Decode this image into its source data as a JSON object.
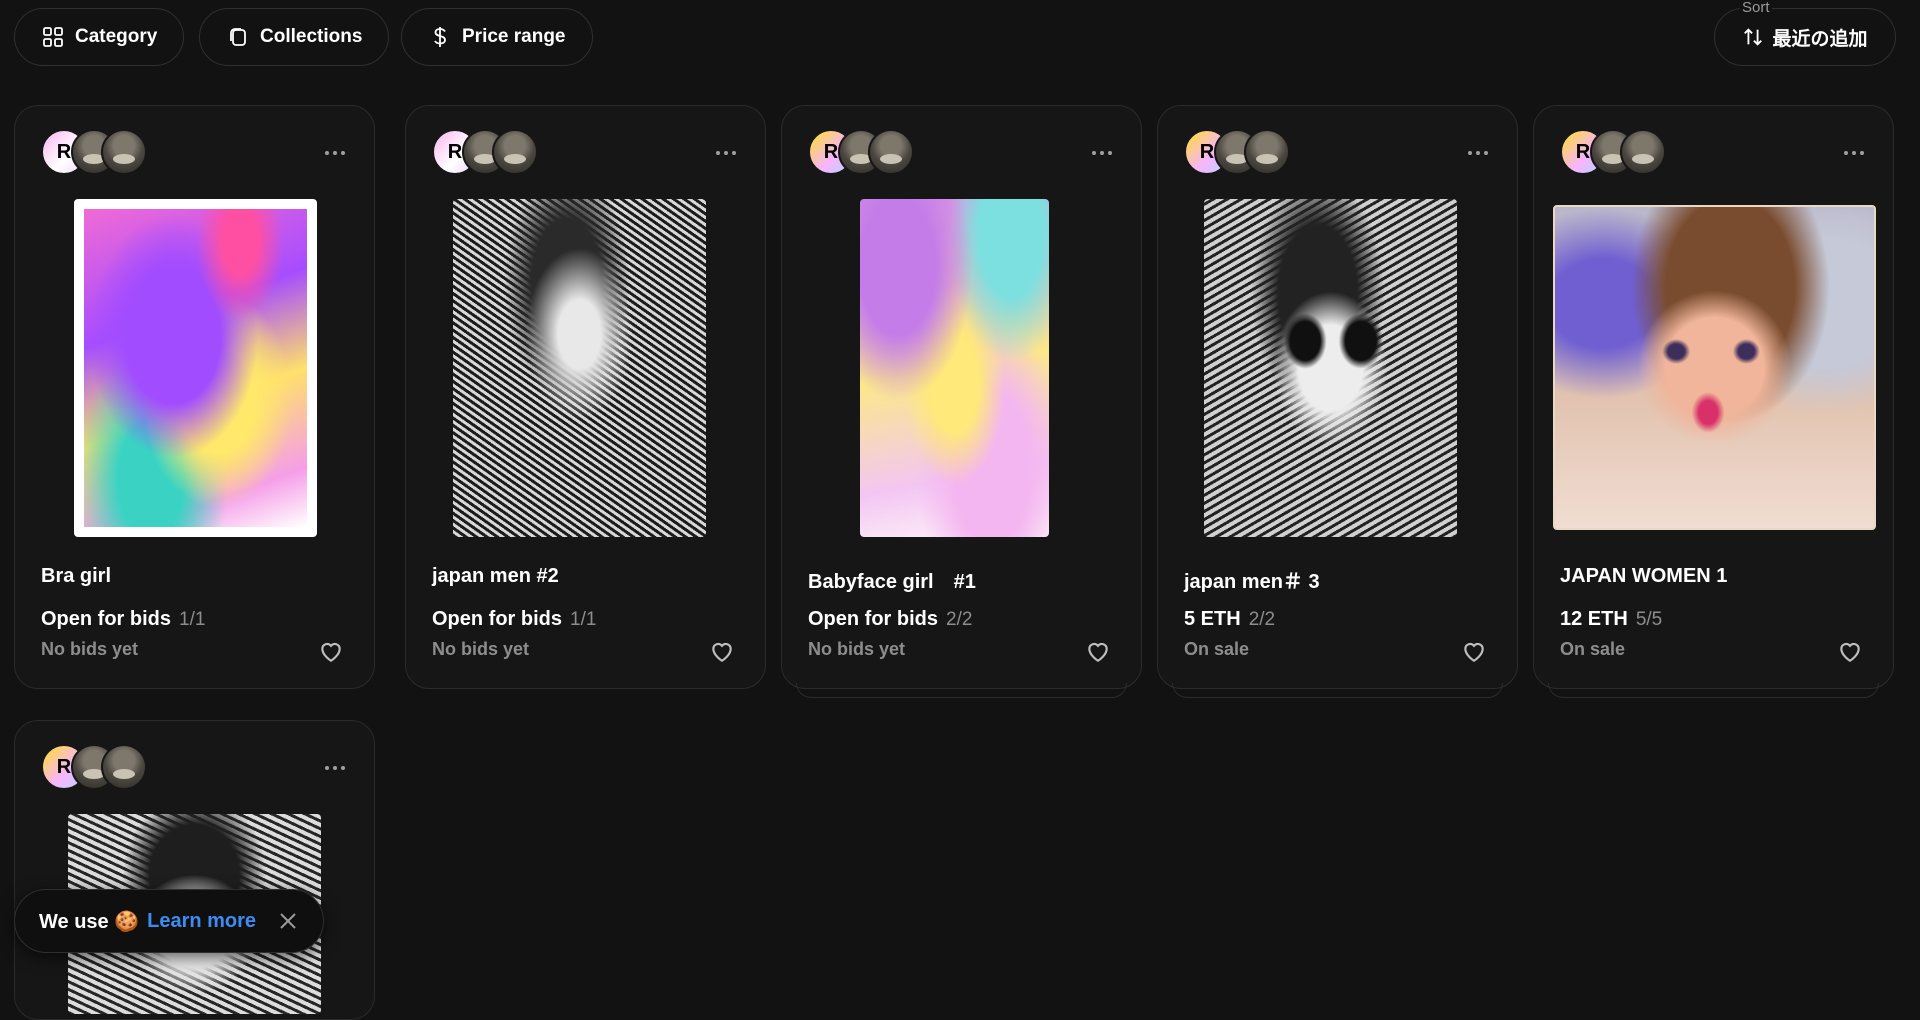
{
  "filters": {
    "category_label": "Category",
    "collections_label": "Collections",
    "price_label": "Price range"
  },
  "sort": {
    "label": "Sort",
    "value": "最近の追加"
  },
  "cards": [
    {
      "title": "Bra girl",
      "price": "Open for bids",
      "count": "1/1",
      "sub": "No bids yet",
      "avatar_badge": "R"
    },
    {
      "title": "japan men #2",
      "price": "Open for bids",
      "count": "1/1",
      "sub": "No bids yet",
      "avatar_badge": "R"
    },
    {
      "title": "Babyface girl　#1",
      "price": "Open for bids",
      "count": "2/2",
      "sub": "No bids yet",
      "avatar_badge": "R"
    },
    {
      "title": "japan men＃ 3",
      "price": "5 ETH",
      "count": "2/2",
      "sub": "On sale",
      "avatar_badge": "R"
    },
    {
      "title": "JAPAN WOMEN 1",
      "price": "12 ETH",
      "count": "5/5",
      "sub": "On sale",
      "avatar_badge": "R"
    },
    {
      "title": "",
      "price": "",
      "count": "",
      "sub": "",
      "avatar_badge": "R"
    }
  ],
  "cookie_banner": {
    "text": "We use 🍪",
    "link": "Learn more"
  },
  "colors": {
    "background": "#121212",
    "card_border": "#2b2b2b",
    "muted_text": "#8d8d8d",
    "link": "#3b8df5"
  }
}
